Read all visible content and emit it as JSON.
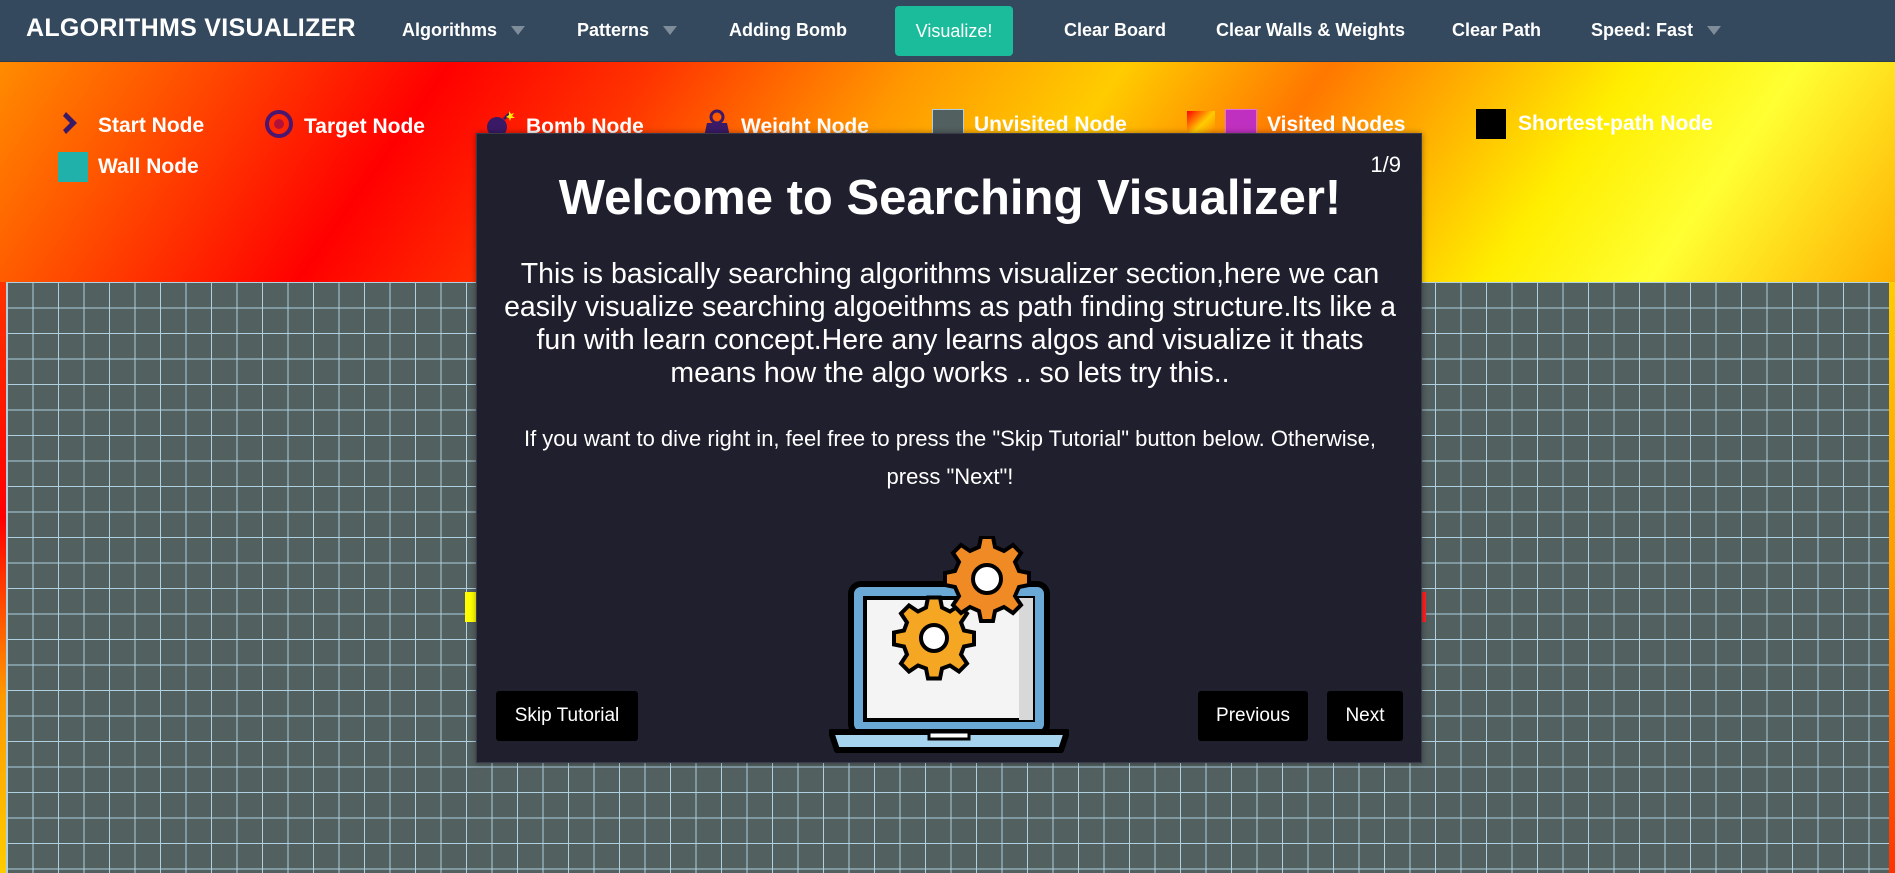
{
  "navbar": {
    "brand": "ALGORITHMS VISUALIZER",
    "items": [
      {
        "label": "Algorithms"
      },
      {
        "label": "Patterns"
      },
      {
        "label": "Adding Bomb"
      },
      {
        "label": "Clear Board"
      },
      {
        "label": "Clear Walls & Weights"
      },
      {
        "label": "Clear Path"
      },
      {
        "label": "Speed: Fast"
      }
    ],
    "visualize_label": "Visualize!",
    "background_color": "#34495e",
    "visualize_color": "#1abc9c"
  },
  "legend": {
    "items": [
      {
        "label": "Start Node",
        "icon": "chevron-right-icon"
      },
      {
        "label": "Target Node",
        "icon": "target-icon"
      },
      {
        "label": "Bomb Node",
        "icon": "bomb-icon"
      },
      {
        "label": "Weight Node",
        "icon": "weight-icon"
      },
      {
        "label": "Unvisited Node",
        "icon": "unvisited-swatch"
      },
      {
        "label": "Visited Nodes",
        "icon": "visited-swatch"
      },
      {
        "label": "Shortest-path Node",
        "icon": "shortest-path-swatch"
      },
      {
        "label": "Wall Node",
        "icon": "wall-swatch"
      }
    ]
  },
  "modal": {
    "counter": "1/9",
    "title": "Welcome to Searching Visualizer!",
    "body": "This is basically searching algorithms visualizer section,here we can easily visualize searching algoeithms as path finding structure.Its like a fun with learn concept.Here any learns algos and visualize it thats means how the algo works .. so lets try this..",
    "sub": "If you want to dive right in, feel free to press the \"Skip Tutorial\" button below. Otherwise, press \"Next\"!",
    "illustration": "laptop-gears-icon",
    "skip_label": "Skip Tutorial",
    "previous_label": "Previous",
    "next_label": "Next"
  }
}
